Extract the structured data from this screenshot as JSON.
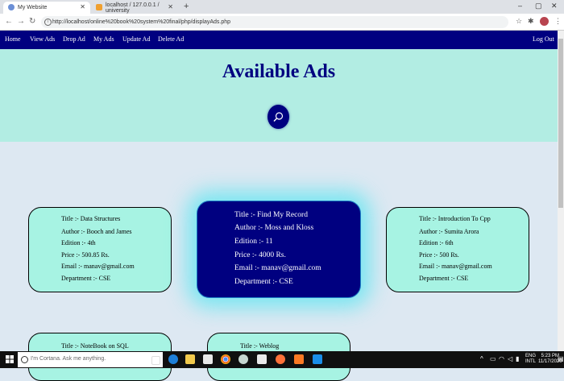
{
  "browser": {
    "tabs": [
      {
        "title": "My Website",
        "active": true
      },
      {
        "title": "localhost / 127.0.0.1 / university",
        "active": false
      }
    ],
    "url": "http://localhost/online%20book%20system%20final/php/displayAds.php"
  },
  "nav": {
    "items": [
      "Home",
      "View Ads",
      "Drop Ad",
      "My Ads",
      "Update Ad",
      "Delete Ad"
    ],
    "logout": "Log Out"
  },
  "hero": {
    "title": "Available Ads"
  },
  "ads": [
    {
      "title": "Title :- Data Structures",
      "author": "Author :- Booch and James",
      "edition": "Edition :- 4th",
      "price": "Price :- 500.85 Rs.",
      "email": "Email :- manav@gmail.com",
      "department": "Department :- CSE"
    },
    {
      "title": "Title :- Find My Record",
      "author": "Author :- Moss and Kloss",
      "edition": "Edition :- 11",
      "price": "Price :- 4000 Rs.",
      "email": "Email :- manav@gmail.com",
      "department": "Department :- CSE"
    },
    {
      "title": "Title :- Introduction To Cpp",
      "author": "Author :- Sumita Arora",
      "edition": "Edition :- 6th",
      "price": "Price :- 500 Rs.",
      "email": "Email :- manav@gmail.com",
      "department": "Department :- CSE"
    },
    {
      "title": "Title :- NoteBook on SQL"
    },
    {
      "title": "Title :- Weblog"
    }
  ],
  "taskbar": {
    "search_placeholder": "I'm Cortana. Ask me anything.",
    "lang": "ENG",
    "layout": "INTL",
    "time": "5:23 PM",
    "date": "11/17/2020"
  },
  "colors": {
    "navbar": "#000080",
    "hero": "#b2ede3",
    "card": "#a7f3e3",
    "featured_card": "#000080",
    "glow": "#5ae6f0"
  }
}
